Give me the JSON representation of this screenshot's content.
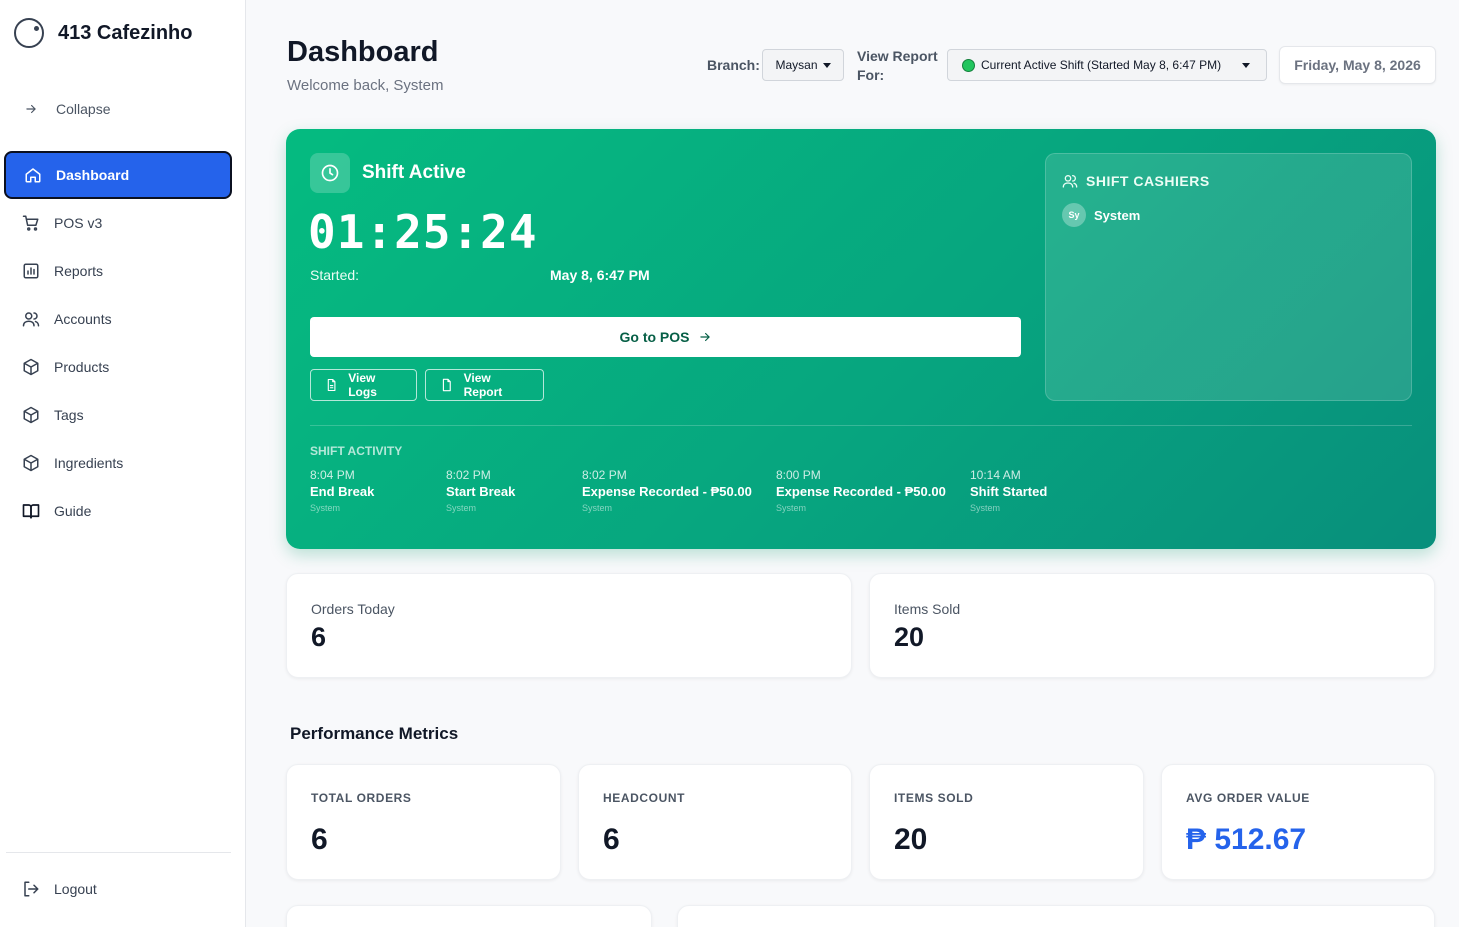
{
  "brand": {
    "name": "413 Cafezinho"
  },
  "sidebar": {
    "collapse_label": "Collapse",
    "items": [
      {
        "label": "Dashboard"
      },
      {
        "label": "POS v3"
      },
      {
        "label": "Reports"
      },
      {
        "label": "Accounts"
      },
      {
        "label": "Products"
      },
      {
        "label": "Tags"
      },
      {
        "label": "Ingredients"
      },
      {
        "label": "Guide"
      }
    ],
    "logout_label": "Logout"
  },
  "header": {
    "title": "Dashboard",
    "subtitle": "Welcome back, System",
    "branch_label": "Branch:",
    "branch_value": "Maysan",
    "report_label_line1": "View Report",
    "report_label_line2": "For:",
    "report_value": "Current Active Shift (Started May 8, 6:47 PM)",
    "date": "Friday, May 8, 2026"
  },
  "shift": {
    "title": "Shift Active",
    "timer": "01:25:24",
    "started_label": "Started:",
    "started_value": "May 8, 6:47 PM",
    "go_pos_label": "Go to POS",
    "view_logs_label": "View Logs",
    "view_report_label": "View Report",
    "cashiers_title": "SHIFT CASHIERS",
    "cashiers": [
      {
        "initials": "Sy",
        "name": "System"
      }
    ],
    "activity_title": "SHIFT ACTIVITY",
    "activity": [
      {
        "time": "8:04 PM",
        "title": "End Break",
        "user": "System"
      },
      {
        "time": "8:02 PM",
        "title": "Start Break",
        "user": "System"
      },
      {
        "time": "8:02 PM",
        "title": "Expense Recorded - ₱50.00",
        "user": "System"
      },
      {
        "time": "8:00 PM",
        "title": "Expense Recorded - ₱50.00",
        "user": "System"
      },
      {
        "time": "10:14 AM",
        "title": "Shift Started",
        "user": "System"
      }
    ]
  },
  "stats": {
    "orders_today_label": "Orders Today",
    "orders_today_value": "6",
    "items_sold_label": "Items Sold",
    "items_sold_value": "20"
  },
  "performance": {
    "title": "Performance Metrics",
    "metrics": [
      {
        "label": "TOTAL ORDERS",
        "value": "6"
      },
      {
        "label": "HEADCOUNT",
        "value": "6"
      },
      {
        "label": "ITEMS SOLD",
        "value": "20"
      },
      {
        "label": "AVG ORDER VALUE",
        "value": "₱ 512.67"
      }
    ]
  },
  "colors": {
    "accent": "#2563eb",
    "shift_green": "#05bb80",
    "status_dot": "#22c55e"
  }
}
